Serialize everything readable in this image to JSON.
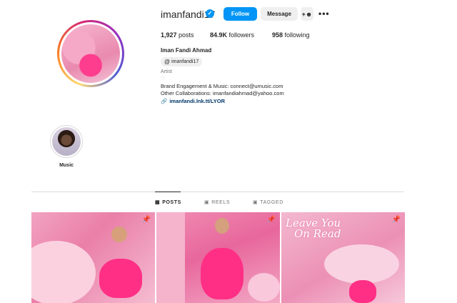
{
  "profile": {
    "username": "imanfandi17",
    "full_name": "Iman Fandi Ahmad",
    "threads_handle": "imanfandi17",
    "category": "Artist",
    "bio_line1": "Brand Engagement & Music: connect@umusic.com",
    "bio_line2": "Other Collaborations: imanfandiahmad@yahoo.com",
    "link": "imanfandi.lnk.tt/LYOR"
  },
  "actions": {
    "follow": "Follow",
    "message": "Message"
  },
  "stats": {
    "posts_count": "1,927",
    "posts_label": "posts",
    "followers_count": "84.9K",
    "followers_label": "followers",
    "following_count": "958",
    "following_label": "following"
  },
  "highlights": [
    {
      "label": "Music"
    }
  ],
  "tabs": [
    {
      "label": "POSTS",
      "active": true
    },
    {
      "label": "REELS",
      "active": false
    },
    {
      "label": "TAGGED",
      "active": false
    }
  ],
  "posts": [
    {
      "pinned": true
    },
    {
      "pinned": true
    },
    {
      "pinned": true,
      "overlay_text_line1": "Leave You",
      "overlay_text_line2": "On Read"
    }
  ],
  "colors": {
    "accent": "#0095f6",
    "link": "#00376b",
    "post_pink": "#ec7fa8"
  }
}
